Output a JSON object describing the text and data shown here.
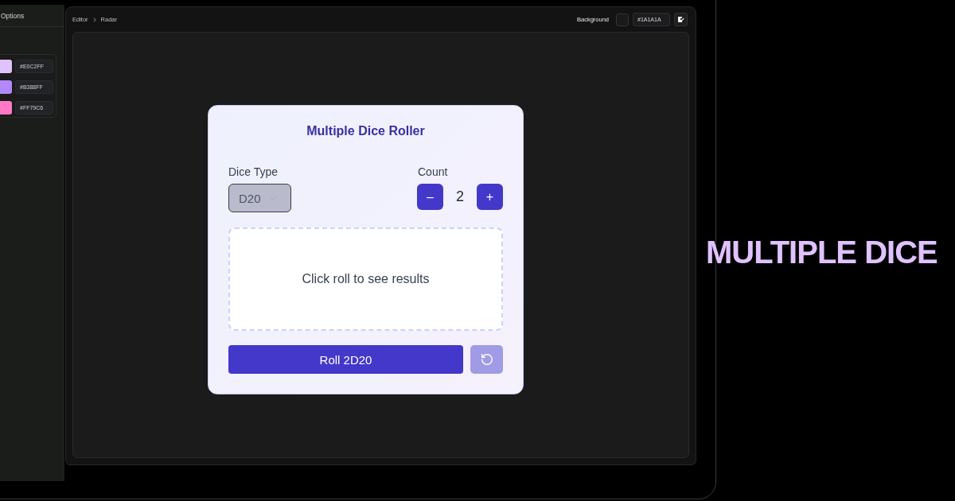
{
  "sidebar": {
    "title": "Options",
    "colors": [
      {
        "hex": "#E0C2FF",
        "color": "#e0c2ff"
      },
      {
        "hex": "#B388FF",
        "color": "#b388ff"
      },
      {
        "hex": "#FF79C6",
        "color": "#ff79c6"
      }
    ]
  },
  "toolbar": {
    "breadcrumb": [
      "Editor",
      "Radar"
    ],
    "background": {
      "label": "Background",
      "value": "#1A1A1A"
    }
  },
  "dialog": {
    "title": "Multiple Dice Roller",
    "dice_type": {
      "label": "Dice Type",
      "value": "D20",
      "disabled": true
    },
    "count": {
      "label": "Count",
      "value": "2",
      "decrement": "–",
      "increment": "+"
    },
    "results": {
      "message": "Click roll to see results"
    },
    "roll_button": "Roll 2D20",
    "reset_button": {
      "disabled": true
    }
  },
  "headline": "MULTIPLE DICE"
}
